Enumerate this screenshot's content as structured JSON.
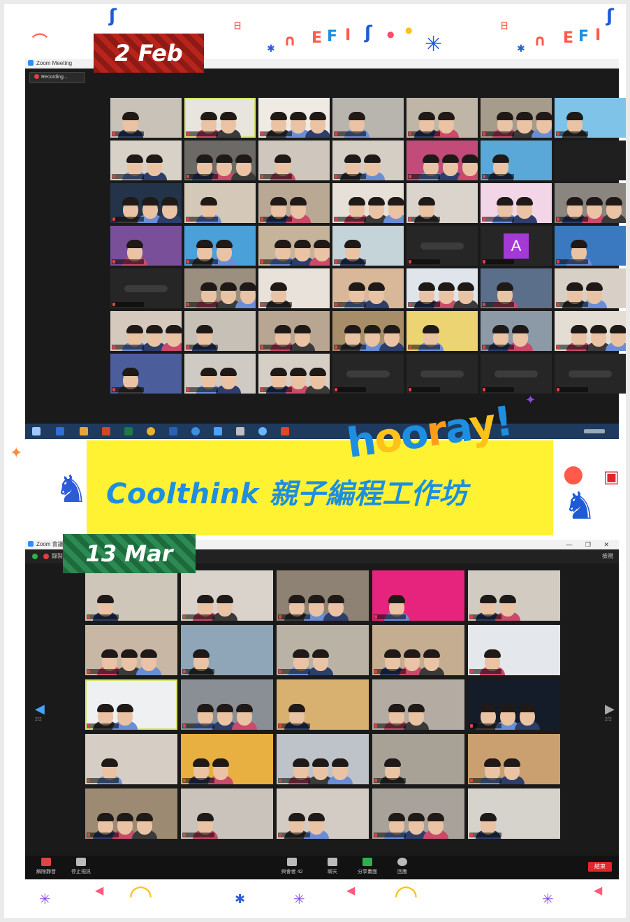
{
  "top_window": {
    "app_title": "Zoom Meeting",
    "recording_label": "Recording...",
    "date_badge": "2 Feb",
    "tiles": [
      {
        "kind": "p",
        "bg": "#c9c2b8"
      },
      {
        "kind": "p",
        "bg": "#e8e4de",
        "highlight": true
      },
      {
        "kind": "p",
        "bg": "#efeae4"
      },
      {
        "kind": "p",
        "bg": "#b8b4ae"
      },
      {
        "kind": "p",
        "bg": "#bfb6a8"
      },
      {
        "kind": "p",
        "bg": "#a69c8c"
      },
      {
        "kind": "p",
        "bg": "#7fc3e8"
      },
      {
        "kind": "p",
        "bg": "#d8d1c8"
      },
      {
        "kind": "p",
        "bg": "#6c6a66"
      },
      {
        "kind": "p",
        "bg": "#cfc7bd"
      },
      {
        "kind": "p",
        "bg": "#d5cec4"
      },
      {
        "kind": "p",
        "bg": "#c24b7a"
      },
      {
        "kind": "p",
        "bg": "#5aa8d8"
      },
      {
        "kind": "empty",
        "bg": "#1f1f1f"
      },
      {
        "kind": "p",
        "bg": "#23344a"
      },
      {
        "kind": "p",
        "bg": "#d4c9b8"
      },
      {
        "kind": "p",
        "bg": "#b8a894"
      },
      {
        "kind": "p",
        "bg": "#e6e0d8"
      },
      {
        "kind": "p",
        "bg": "#dad4cc"
      },
      {
        "kind": "p",
        "bg": "#f2d6e8"
      },
      {
        "kind": "p",
        "bg": "#8a857e"
      },
      {
        "kind": "p",
        "bg": "#7a4f9a"
      },
      {
        "kind": "p",
        "bg": "#4aa0d8"
      },
      {
        "kind": "p",
        "bg": "#c6b49a"
      },
      {
        "kind": "p",
        "bg": "#c4d4d8"
      },
      {
        "kind": "blur",
        "bg": "#262626"
      },
      {
        "kind": "avatar",
        "bg": "#262626",
        "letter": "A"
      },
      {
        "kind": "p",
        "bg": "#3a78c0"
      },
      {
        "kind": "blur",
        "bg": "#262626"
      },
      {
        "kind": "p",
        "bg": "#9b8f80"
      },
      {
        "kind": "p",
        "bg": "#e8e2da"
      },
      {
        "kind": "p",
        "bg": "#d9b89a"
      },
      {
        "kind": "p",
        "bg": "#dfe5ea"
      },
      {
        "kind": "p",
        "bg": "#5b6e8a"
      },
      {
        "kind": "p",
        "bg": "#d8d0c6"
      },
      {
        "kind": "p",
        "bg": "#d4c9bc"
      },
      {
        "kind": "p",
        "bg": "#c7c0b6"
      },
      {
        "kind": "p",
        "bg": "#b9a692"
      },
      {
        "kind": "p",
        "bg": "#a88e68"
      },
      {
        "kind": "p",
        "bg": "#ecd472"
      },
      {
        "kind": "p",
        "bg": "#8c9aa8"
      },
      {
        "kind": "p",
        "bg": "#e4ddd4"
      },
      {
        "kind": "p",
        "bg": "#4b5d9a"
      },
      {
        "kind": "p",
        "bg": "#cfcac4"
      },
      {
        "kind": "p",
        "bg": "#d6cfc6"
      },
      {
        "kind": "blur",
        "bg": "#262626"
      },
      {
        "kind": "blur",
        "bg": "#262626"
      },
      {
        "kind": "blur",
        "bg": "#262626"
      },
      {
        "kind": "blur",
        "bg": "#262626"
      }
    ]
  },
  "banner": {
    "title": "Coolthink 親子編程工作坊",
    "hooray": [
      "h",
      "o",
      "o",
      "r",
      "a",
      "y"
    ],
    "hooray_mark": "!"
  },
  "bottom_window": {
    "app_title": "Zoom 會議",
    "recording_label": "錄製",
    "view_label": "檢視",
    "window_controls": "— ❐ ✕",
    "date_badge": "13 Mar",
    "page_left": "2/2",
    "page_right": "2/2",
    "tiles": [
      {
        "kind": "p",
        "bg": "#cfc6ba"
      },
      {
        "kind": "p",
        "bg": "#d9d3cb"
      },
      {
        "kind": "p",
        "bg": "#8d8274"
      },
      {
        "kind": "p",
        "bg": "#e6247e"
      },
      {
        "kind": "p",
        "bg": "#d2cbc1"
      },
      {
        "kind": "p",
        "bg": "#c8b7a4"
      },
      {
        "kind": "p",
        "bg": "#8fa6b8"
      },
      {
        "kind": "p",
        "bg": "#bbb2a6"
      },
      {
        "kind": "p",
        "bg": "#c4ad90"
      },
      {
        "kind": "p",
        "bg": "#e4e8ec"
      },
      {
        "kind": "p",
        "bg": "#eef0f2",
        "highlight": true
      },
      {
        "kind": "p",
        "bg": "#8a8f96"
      },
      {
        "kind": "p",
        "bg": "#d8b070"
      },
      {
        "kind": "p",
        "bg": "#b4aca2"
      },
      {
        "kind": "p",
        "bg": "#141c2a"
      },
      {
        "kind": "p",
        "bg": "#d6cec4"
      },
      {
        "kind": "p",
        "bg": "#e8b040"
      },
      {
        "kind": "p",
        "bg": "#bdc3c8"
      },
      {
        "kind": "p",
        "bg": "#a8a196"
      },
      {
        "kind": "p",
        "bg": "#caa070"
      },
      {
        "kind": "p",
        "bg": "#9c8a72"
      },
      {
        "kind": "p",
        "bg": "#c9c3bc"
      },
      {
        "kind": "p",
        "bg": "#d2ccc4"
      },
      {
        "kind": "p",
        "bg": "#a8a29a"
      },
      {
        "kind": "p",
        "bg": "#d6d2cc"
      }
    ],
    "controls": [
      {
        "label": "解除靜音",
        "color": "#d44"
      },
      {
        "label": "停止視訊",
        "color": "#bbb"
      },
      {
        "label": "與會者 42",
        "color": "#bbb"
      },
      {
        "label": "聊天",
        "color": "#bbb"
      },
      {
        "label": "分享畫面",
        "color": "#31b04a"
      },
      {
        "label": "回應",
        "color": "#bbb"
      }
    ],
    "end_label": "結束"
  }
}
